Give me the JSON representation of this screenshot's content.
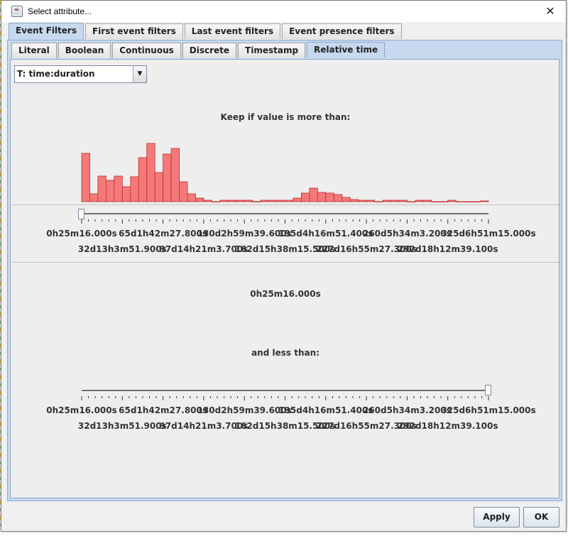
{
  "window": {
    "title": "Select attribute..."
  },
  "outer_tabs": [
    "Event Filters",
    "First event filters",
    "Last event filters",
    "Event presence filters"
  ],
  "outer_active": 0,
  "inner_tabs": [
    "Literal",
    "Boolean",
    "Continuous",
    "Discrete",
    "Timestamp",
    "Relative time"
  ],
  "inner_active": 5,
  "attribute_select": {
    "value": "T: time:duration"
  },
  "lower_filter": {
    "label": "Keep if value is more than:",
    "value_label": "0h25m16.000s",
    "slider_fraction": 0.0
  },
  "upper_filter": {
    "label": "and less than:",
    "slider_fraction": 1.0
  },
  "axis_labels_top": [
    "0h25m16.000s",
    "65d1h42m27.800s",
    "130d2h59m39.600s",
    "195d4h16m51.400s",
    "260d5h34m3.200s",
    "325d6h51m15.000s"
  ],
  "axis_labels_bottom": [
    "32d13h3m51.900s",
    "97d14h21m3.700s",
    "162d15h38m15.500s",
    "227d16h55m27.300s",
    "292d18h12m39.100s"
  ],
  "histogram": {
    "bar_color": "#f47a7a",
    "edge_color": "#c42b2b",
    "counts": [
      68,
      11,
      36,
      30,
      36,
      21,
      35,
      62,
      82,
      41,
      67,
      75,
      28,
      11,
      5,
      2,
      0,
      2,
      2,
      2,
      2,
      0,
      2,
      2,
      2,
      2,
      5,
      12,
      19,
      13,
      12,
      10,
      6,
      3,
      2,
      2,
      0,
      2,
      2,
      2,
      0,
      2,
      2,
      0,
      0,
      2,
      0,
      0,
      0,
      1
    ]
  },
  "buttons": {
    "apply": "Apply",
    "ok": "OK"
  }
}
